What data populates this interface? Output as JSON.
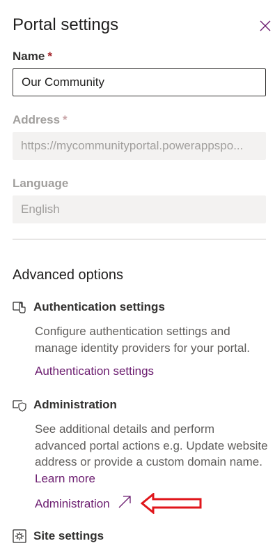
{
  "panel": {
    "title": "Portal settings"
  },
  "name": {
    "label": "Name",
    "required_mark": "*",
    "value": "Our Community"
  },
  "address": {
    "label": "Address",
    "required_mark": "*",
    "value": "https://mycommunityportal.powerappspo..."
  },
  "language": {
    "label": "Language",
    "value": "English"
  },
  "advanced": {
    "title": "Advanced options",
    "authentication": {
      "heading": "Authentication settings",
      "description": "Configure authentication settings and manage identity providers for your portal.",
      "link": "Authentication settings"
    },
    "administration": {
      "heading": "Administration",
      "description": "See additional details and perform advanced portal actions e.g. Update website address or provide a custom domain name.",
      "learn_more": "Learn more",
      "link": "Administration"
    },
    "site_settings": {
      "heading": "Site settings"
    }
  },
  "colors": {
    "link": "#6b1c6f",
    "annotation_arrow": "#e0161b",
    "required": "#a4262c"
  }
}
